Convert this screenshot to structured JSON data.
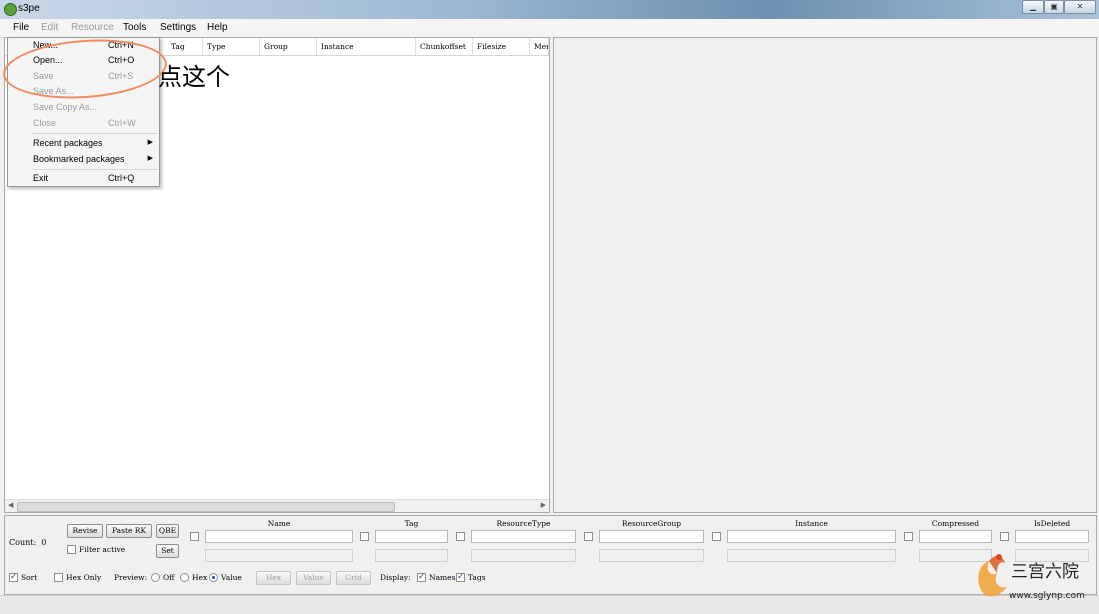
{
  "window": {
    "title": "s3pe"
  },
  "menu": {
    "items": [
      {
        "label": "File",
        "enabled": true
      },
      {
        "label": "Edit",
        "enabled": false
      },
      {
        "label": "Resource",
        "enabled": false
      },
      {
        "label": "Tools",
        "enabled": true
      },
      {
        "label": "Settings",
        "enabled": true
      },
      {
        "label": "Help",
        "enabled": true
      }
    ]
  },
  "file_menu": {
    "new": {
      "label": "New...",
      "shortcut": "Ctrl+N"
    },
    "open": {
      "label": "Open...",
      "shortcut": "Ctrl+O"
    },
    "save": {
      "label": "Save",
      "shortcut": "Ctrl+S"
    },
    "save_as": {
      "label": "Save As...",
      "shortcut": ""
    },
    "save_copy_as": {
      "label": "Save Copy As...",
      "shortcut": ""
    },
    "close": {
      "label": "Close",
      "shortcut": "Ctrl+W"
    },
    "recent": {
      "label": "Recent packages"
    },
    "bookmarked": {
      "label": "Bookmarked packages"
    },
    "exit": {
      "label": "Exit",
      "shortcut": "Ctrl+Q"
    }
  },
  "annotation": {
    "text": "点这个",
    "color": "#f08a5d"
  },
  "grid": {
    "columns": [
      "Tag",
      "Type",
      "Group",
      "Instance",
      "Chunkoffset",
      "Filesize",
      "Mem"
    ]
  },
  "bottom": {
    "count_label": "Count:",
    "count_value": "0",
    "revise": "Revise",
    "paste_rk": "Paste RK",
    "qbe": "QBE",
    "set": "Set",
    "filter_active": "Filter active",
    "filter_headers": [
      "Name",
      "Tag",
      "ResourceType",
      "ResourceGroup",
      "Instance",
      "Compressed",
      "IsDeleted"
    ],
    "sort": "Sort",
    "hex_only": "Hex Only",
    "preview_label": "Preview:",
    "preview_off": "Off",
    "preview_hex": "Hex",
    "preview_value": "Value",
    "btn_hex": "Hex",
    "btn_value": "Value",
    "btn_grid": "Grid",
    "display_label": "Display:",
    "names": "Names",
    "tags": "Tags"
  },
  "watermark": {
    "text": "三宫六院",
    "url": "www.sglynp.com"
  }
}
